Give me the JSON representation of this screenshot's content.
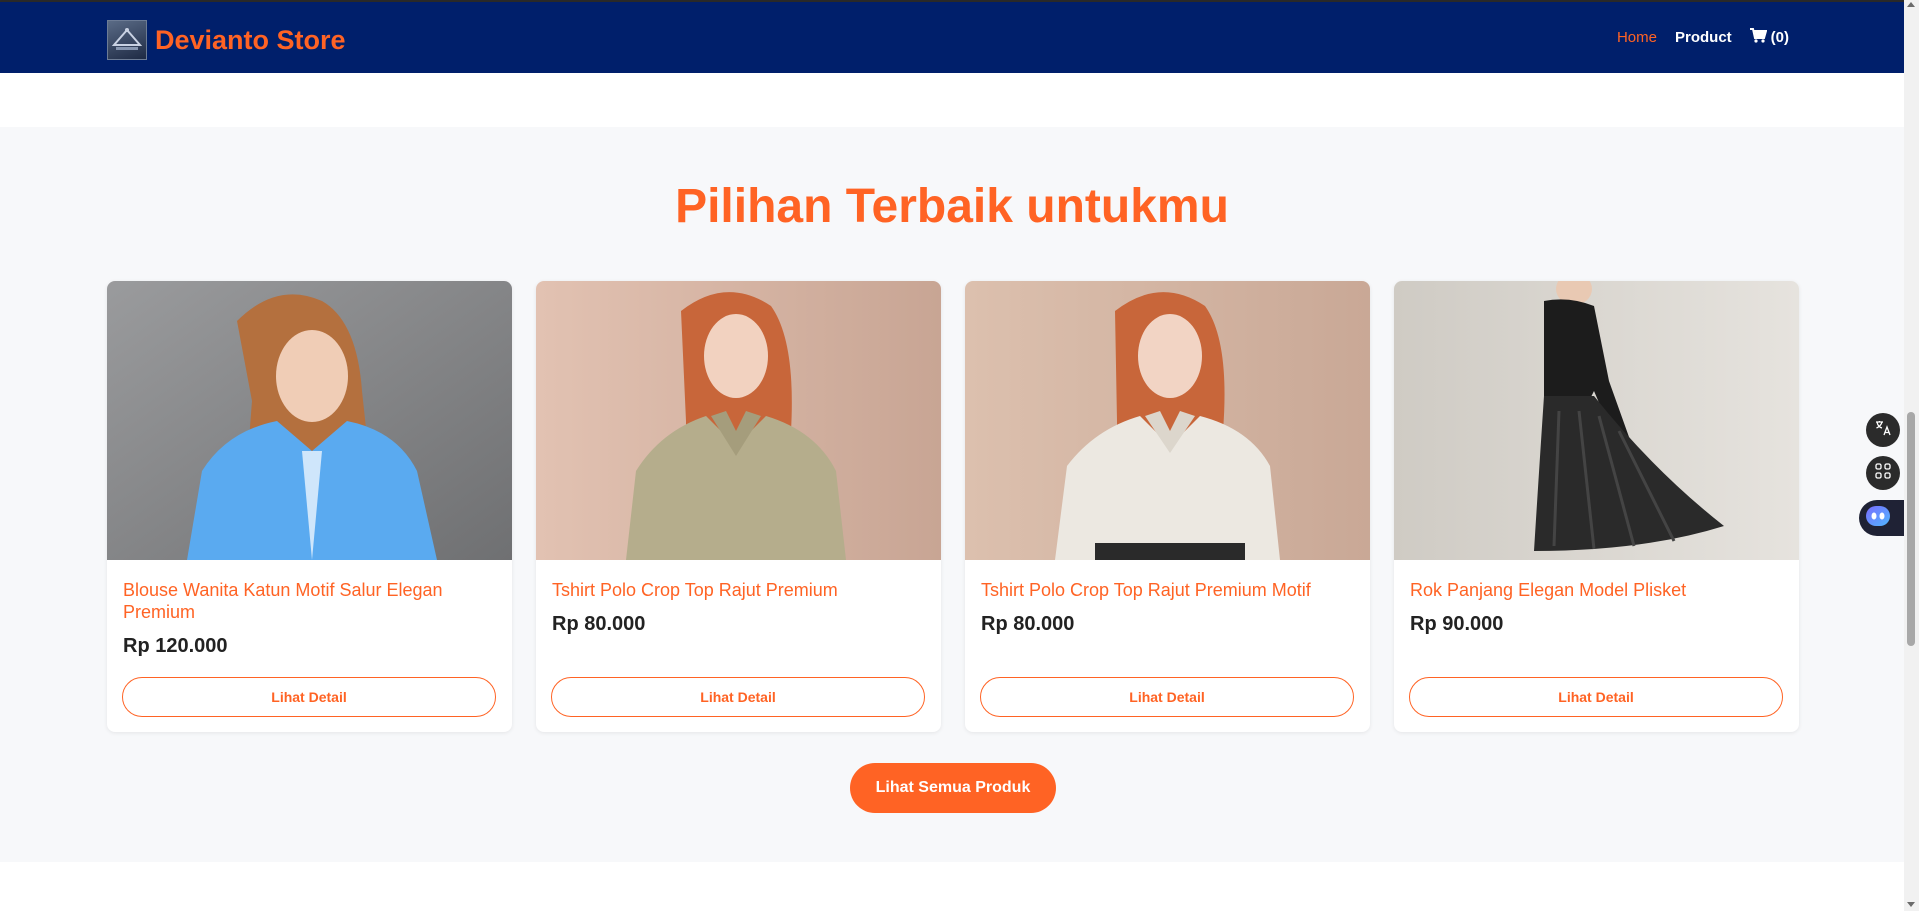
{
  "brand": {
    "name": "Devianto Store"
  },
  "nav": {
    "home": "Home",
    "product": "Product",
    "cart_count": "(0)"
  },
  "section": {
    "title": "Pilihan Terbaik untukmu"
  },
  "products": [
    {
      "name": "Blouse Wanita Katun Motif Salur Elegan Premium",
      "price": "Rp 120.000",
      "button": "Lihat Detail"
    },
    {
      "name": "Tshirt Polo Crop Top Rajut Premium",
      "price": "Rp 80.000",
      "button": "Lihat Detail"
    },
    {
      "name": "Tshirt Polo Crop Top Rajut Premium Motif",
      "price": "Rp 80.000",
      "button": "Lihat Detail"
    },
    {
      "name": "Rok Panjang Elegan Model Plisket",
      "price": "Rp 90.000",
      "button": "Lihat Detail"
    }
  ],
  "view_all_button": "Lihat Semua Produk",
  "icons": {
    "cart": "cart-icon",
    "translate": "translate-icon",
    "apps": "apps-icon",
    "assistant": "assistant-icon"
  },
  "colors": {
    "navbar": "#001f6b",
    "accent": "#ff6324",
    "section_bg": "#f7f8fa"
  }
}
